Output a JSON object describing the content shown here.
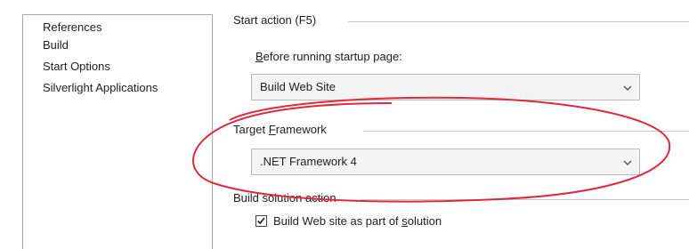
{
  "nav": {
    "items": [
      {
        "label": "References"
      },
      {
        "label": "Build"
      },
      {
        "label": "Start Options"
      },
      {
        "label": "Silverlight Applications"
      }
    ]
  },
  "start_action": {
    "header": "Start action (F5)",
    "before_label_accel": "B",
    "before_label_rest": "efore running startup page:",
    "before_value": "Build Web Site"
  },
  "target_framework": {
    "label_start": "Target ",
    "label_accel": "F",
    "label_rest": "ramework",
    "value": ".NET Framework 4"
  },
  "build_solution": {
    "header": "Build solution action",
    "checkbox_checked": true,
    "checkbox_label_start": "Build Web site as part of ",
    "checkbox_label_accel": "s",
    "checkbox_label_rest": "olution"
  },
  "colors": {
    "annotation": "#e0283c"
  }
}
